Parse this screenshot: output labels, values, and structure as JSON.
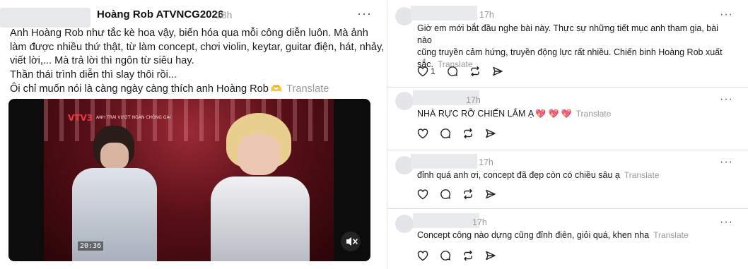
{
  "post": {
    "username": "Hoàng Rob ATVNCG2026",
    "time": "18h",
    "more_label": "···",
    "lines": [
      "Anh Hoàng Rob như tắc kè hoa vậy, biến hóa qua mỗi công diễn luôn. Mà ảnh",
      "làm được nhiều thứ thật, từ làm concept, chơi violin, keytar, guitar điện, hát, nhảy,",
      "viết lời,... Mà trả lời thì ngôn từ siêu hay.",
      "Thần thái trình diễn thì slay thôi rồi...",
      "Ôi chỉ muốn nói là càng ngày càng thích anh Hoàng Rob"
    ],
    "emoji": "🫶",
    "translate_label": "Translate",
    "video": {
      "channel_logo": "VTV3",
      "caption": "ANH TRAI VƯỢT NGÀN CHÔNG GAI",
      "timestamp": "20:36",
      "mute_icon": "muted-speaker-icon"
    }
  },
  "comments": [
    {
      "time": "17h",
      "more_label": "···",
      "lines": [
        "Giờ em mới bắt đầu nghe bài này. Thực sự những tiết mục anh tham gia, bài nào",
        "cũng truyền cảm hứng, truyền động lực rất nhiều. Chiến binh Hoàng Rob xuất",
        "sắc."
      ],
      "translate_label": "Translate",
      "like_count": "1"
    },
    {
      "time": "17h",
      "more_label": "···",
      "lines": [
        "NHÀ RỰC RỠ CHIẾN LẮM Ạ"
      ],
      "hearts": "💖 💖 💖",
      "translate_label": "Translate",
      "like_count": ""
    },
    {
      "time": "17h",
      "more_label": "···",
      "lines": [
        "đỉnh quá anh ơi, concept đã đẹp còn có chiều sâu ạ"
      ],
      "translate_label": "Translate",
      "like_count": ""
    },
    {
      "time": "17h",
      "more_label": "···",
      "lines": [
        "Concept công nào dựng cũng đỉnh điên, giỏi quá, khen nha"
      ],
      "translate_label": "Translate",
      "like_count": ""
    }
  ],
  "icons": {
    "like": "heart-icon",
    "reply": "comment-bubble-icon",
    "repost": "repost-icon",
    "share": "send-icon"
  },
  "colors": {
    "text": "#101010",
    "muted": "#999999",
    "divider": "#e2e2e2",
    "heart": "#e8476a"
  }
}
